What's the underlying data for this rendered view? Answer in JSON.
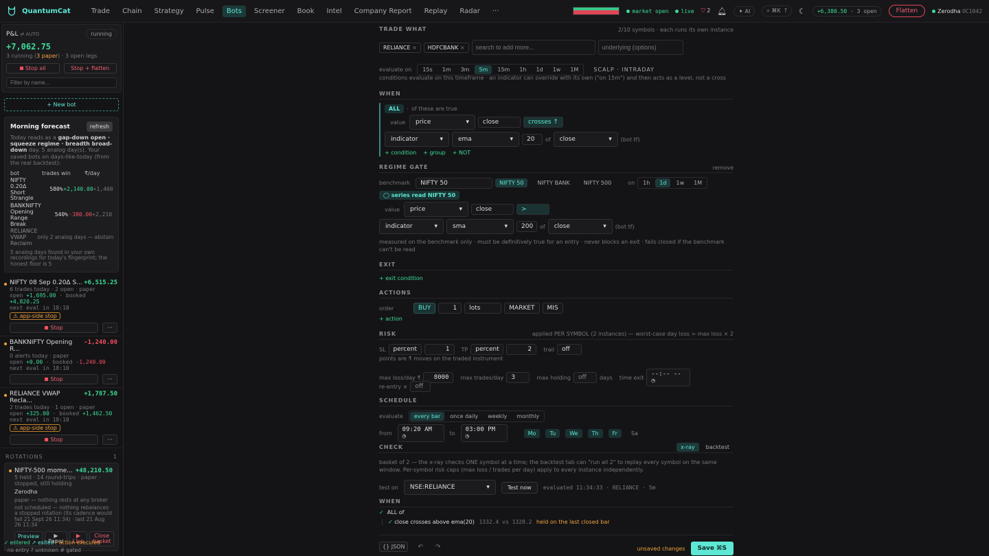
{
  "app": {
    "name": "QuantumCat"
  },
  "nav": [
    "Trade",
    "Chain",
    "Strategy",
    "Pulse",
    "Bots",
    "Screener",
    "Book",
    "Intel",
    "Company Report",
    "Replay",
    "Radar",
    "···"
  ],
  "nav_active": 4,
  "topbar": {
    "market": "market open",
    "live": "live",
    "alerts": "2",
    "ai": "AI",
    "kbd": "⌘K",
    "help": "?",
    "pnl": "+6,380.50",
    "open": "3 open",
    "flatten": "Flatten",
    "broker": "Zerodha",
    "account": "OC1042"
  },
  "sidebar": {
    "pnl_label": "P&L",
    "auto": "AUTO",
    "running_badge": "running",
    "pnl_value": "+7,062.75",
    "running_pre": "3 running (",
    "running_paper": "3 paper",
    ")": "",
    "running_post": ") · 3 open legs",
    "stop_all": "Stop all",
    "stop_flatten": "Stop + flatten",
    "filter_ph": "Filter by name...",
    "new_bot": "+ New bot",
    "forecast": {
      "title": "Morning forecast",
      "refresh": "refresh",
      "desc_a": "Today reads as a ",
      "desc_b": "gap-down open · squeeze regime · breadth broad-down",
      "desc_c": " day. 5 analog day(s). Your saved bots on days-like-today (from the real backtest):",
      "headers": [
        "bot",
        "trades win",
        "₹/day"
      ],
      "rows": [
        {
          "bot": "NIFTY 0.20Δ Short Strangle",
          "trades": "5",
          "win": "80%",
          "day": "+2,140.00",
          "extra": "+1,460."
        },
        {
          "bot": "BANKNIFTY Opening Range Break",
          "trades": "5",
          "win": "40%",
          "day": "-380.00",
          "extra": "+2,210."
        },
        {
          "bot": "RELIANCE VWAP Reclaim",
          "note": "only 2 analog days — abstain"
        }
      ],
      "footer": "5 analog days found in your own recordings for today's fingerprint; the honest floor is 5"
    },
    "bots": [
      {
        "name": "NIFTY 08 Sep 0.20Δ S...",
        "pnl": "+6,515.25",
        "sub": "6 trades today · 2 open · paper",
        "open": "+1,695.00",
        "booked": "+4,820.25",
        "next": "next eval in 18:10",
        "warn": "app-side stop"
      },
      {
        "name": "BANKNIFTY Opening R...",
        "pnl": "-1,240.00",
        "sub": "0 alerts today · paper",
        "open": "+0.00",
        "booked": "-1,240.00",
        "next": "next eval in 18:10",
        "warn": ""
      },
      {
        "name": "RELIANCE VWAP Recla...",
        "pnl": "+1,787.50",
        "sub": "2 trades today · 1 open · paper",
        "open": "+325.00",
        "booked": "+1,462.50",
        "next": "next eval in 18:10",
        "warn": "app-side stop"
      }
    ],
    "stop": "Stop",
    "more": "···",
    "open_label": "open",
    "booked_label": "booked",
    "rotations": {
      "label": "ROTATIONS",
      "count": "1",
      "name": "NIFTY-500 mome...",
      "pnl": "+48,210.50",
      "sub": "5 held · 14 round-trips · paper · stopped, still holding",
      "broker": "Zerodha",
      "paper": "paper — nothing rests at any broker",
      "note": "not scheduled — nothing rebalances a stopped rotation (its cadence would fall 21 Sept 26 11:34) · last 21 Aug 26 11:34",
      "preview": "Preview",
      "paper_btn": "▶ Paper",
      "live_btn": "▶ Live",
      "close_btn": "Close basket"
    },
    "legend1": [
      "✓ entered",
      "↗ exited",
      "! action executed"
    ],
    "legend2": [
      "· no entry",
      "? unknown",
      "# gated"
    ]
  },
  "editor": {
    "trade_what": "TRADE WHAT",
    "symbols_note": "2/10 symbols · each runs its own instance",
    "symbols": [
      "RELIANCE",
      "HDFCBANK"
    ],
    "search_ph": "search to add more...",
    "underlying_ph": "underlying (options)",
    "evaluate_on": "evaluate on",
    "tfs": [
      "15s",
      "1m",
      "3m",
      "5m",
      "15m",
      "1h",
      "1d",
      "1w",
      "1M"
    ],
    "tf_active": 3,
    "style": "SCALP · INTRADAY",
    "tf_note": "conditions evaluate on this timeframe · an indicator can override with its own (\"on 15m\") and then acts as a level, not a cross",
    "when": "WHEN",
    "all": "ALL",
    "all_note": "of these are true",
    "c1": {
      "value": "value",
      "src": "price",
      "field": "close",
      "op": "crosses ↑"
    },
    "c2": {
      "kind": "indicator",
      "ind": "ema",
      "period": "20",
      "of": "of",
      "field": "close",
      "tf": "(bot tf)"
    },
    "add_cond": "+ condition",
    "add_group": "+ group",
    "add_not": "+ NOT",
    "regime": "REGIME GATE",
    "remove": "remove",
    "benchmark": "benchmark",
    "bench_val": "NIFTY 50",
    "benches": [
      "NIFTY 50",
      "NIFTY BANK",
      "NIFTY 500"
    ],
    "on": "on",
    "rtfs": [
      "1h",
      "1d",
      "1w",
      "1M"
    ],
    "rtf_active": 1,
    "series": "series read NIFTY 50",
    "r1": {
      "value": "value",
      "src": "price",
      "field": "close",
      "op": ">"
    },
    "r2": {
      "kind": "indicator",
      "ind": "sma",
      "period": "200",
      "of": "of",
      "field": "close",
      "tf": "(bot tf)"
    },
    "regime_note": "measured on the benchmark only · must be definitively true for an entry · never blocks an exit · fails closed if the benchmark can't be read",
    "exit": "EXIT",
    "exit_add": "+ exit condition",
    "actions": "ACTIONS",
    "order": "order",
    "side": "BUY",
    "qty": "1",
    "unit": "lots",
    "type": "MARKET",
    "product": "MIS",
    "add_action": "+ action",
    "risk": "RISK",
    "risk_note": "applied PER SYMBOL (2 instances) — worst-case day loss = max loss × 2",
    "sl": "SL",
    "sl_mode": "percent",
    "sl_val": "1",
    "tp": "TP",
    "tp_mode": "percent",
    "tp_val": "2",
    "trail": "trail",
    "trail_val": "off",
    "points_note": "points are ₹ moves on the traded instrument",
    "maxloss": "max loss/day ₹",
    "maxloss_val": "8000",
    "maxtrades": "max trades/day",
    "maxtrades_val": "3",
    "maxhold": "max holding",
    "maxhold_val": "off",
    "days": "days",
    "timeexit": "time exit",
    "timeexit_val": "--:-- --",
    "reentry": "re-entry ×",
    "reentry_val": "off",
    "schedule": "SCHEDULE",
    "evaluate": "evaluate",
    "sched": [
      "every bar",
      "once daily",
      "weekly",
      "monthly"
    ],
    "from": "from",
    "from_val": "09:20 AM",
    "to": "to",
    "to_val": "03:00 PM",
    "days_list": [
      "Mo",
      "Tu",
      "We",
      "Th",
      "Fr",
      "Sa"
    ],
    "check": "CHECK",
    "xray": "x-ray",
    "backtest": "backtest",
    "check_note": "basket of 2 — the x-ray checks ONE symbol at a time; the backtest tab can \"run all 2\" to replay every symbol on the same window. Per-symbol risk caps (max loss / trades per day) apply to every instance independently.",
    "test_on": "test on",
    "test_sym": "NSE:RELIANCE",
    "test_now": "Test now",
    "evaluated": "evaluated 11:34:33 · RELIANCE · 5m",
    "res_when": "WHEN",
    "res_all": "ALL of",
    "res_line": "close crosses above ema(20)",
    "res_vals": "1332.4 vs 1328.2",
    "res_held": "held on the last closed bar",
    "json": "{} JSON",
    "unsaved": "unsaved changes",
    "save": "Save ⌘S"
  }
}
